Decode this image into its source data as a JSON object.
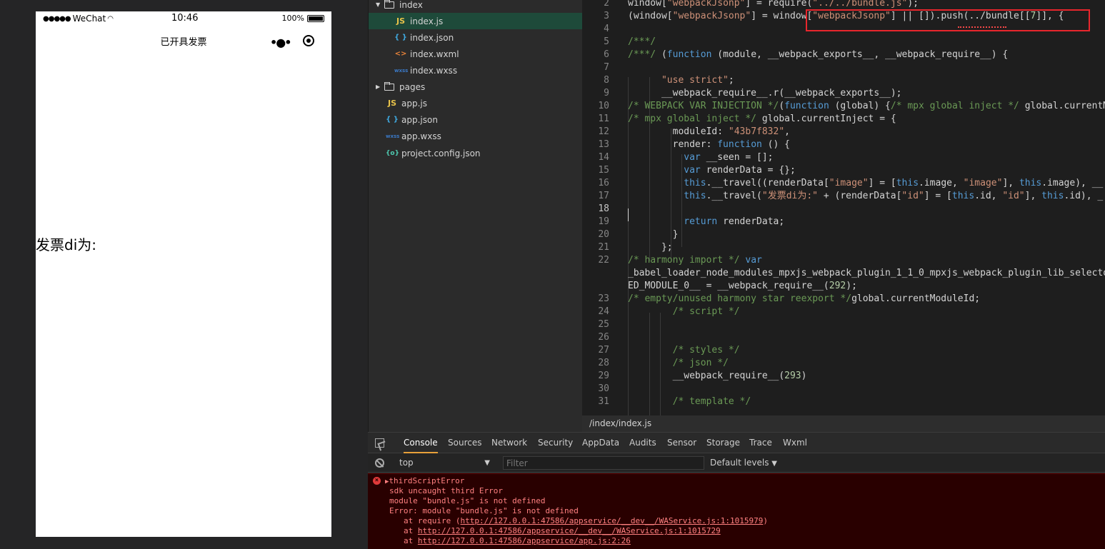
{
  "simulator": {
    "status": {
      "carrier": "WeChat",
      "time": "10:46",
      "battery": "100%"
    },
    "nav_title": "已开具发票",
    "page_text": "发票di为:"
  },
  "file_tree": {
    "items": [
      {
        "type": "folder-open",
        "label": "index"
      },
      {
        "type": "js",
        "label": "index.js",
        "selected": true
      },
      {
        "type": "json",
        "label": "index.json"
      },
      {
        "type": "wxml",
        "label": "index.wxml"
      },
      {
        "type": "wxss",
        "label": "index.wxss"
      },
      {
        "type": "folder-closed",
        "label": "pages"
      },
      {
        "type": "js",
        "label": "app.js"
      },
      {
        "type": "json",
        "label": "app.json"
      },
      {
        "type": "wxss",
        "label": "app.wxss"
      },
      {
        "type": "config",
        "label": "project.config.json"
      }
    ]
  },
  "editor": {
    "lines": [
      {
        "num": "2",
        "text": "window[\"webpackJsonp\"] = require(\"../../bundle.js\");"
      },
      {
        "num": "3",
        "text": "(window[\"webpackJsonp\"] = window[\"webpackJsonp\"] || []).push(../bundle[[7]], {"
      },
      {
        "num": "4",
        "text": ""
      },
      {
        "num": "5",
        "text": "/***/"
      },
      {
        "num": "6",
        "text": "/***/ (function (module, __webpack_exports__, __webpack_require__) {"
      },
      {
        "num": "7",
        "text": ""
      },
      {
        "num": "8",
        "text": "      \"use strict\";"
      },
      {
        "num": "9",
        "text": "      __webpack_require__.r(__webpack_exports__);"
      },
      {
        "num": "10",
        "text": "/* WEBPACK VAR INJECTION */(function (global) {/* mpx global inject */ global.currentMo"
      },
      {
        "num": "11",
        "text": "/* mpx global inject */ global.currentInject = {"
      },
      {
        "num": "12",
        "text": "        moduleId: \"43b7f832\","
      },
      {
        "num": "13",
        "text": "        render: function () {"
      },
      {
        "num": "14",
        "text": "          var __seen = [];"
      },
      {
        "num": "15",
        "text": "          var renderData = {};"
      },
      {
        "num": "16",
        "text": "          this.__travel((renderData[\"image\"] = [this.image, \"image\"], this.image), __"
      },
      {
        "num": "17",
        "text": "          this.__travel(\"发票di为:\" + (renderData[\"id\"] = [this.id, \"id\"], this.id), _"
      },
      {
        "num": "18",
        "text": ""
      },
      {
        "num": "19",
        "text": "          return renderData;"
      },
      {
        "num": "20",
        "text": "        }"
      },
      {
        "num": "21",
        "text": "      };"
      },
      {
        "num": "22",
        "text": "/* harmony import */ var"
      },
      {
        "num": "",
        "text": "_babel_loader_node_modules_mpxjs_webpack_plugin_1_1_0_mpxjs_webpack_plugin_lib_selector"
      },
      {
        "num": "",
        "text": "ED_MODULE_0__ = __webpack_require__(292);"
      },
      {
        "num": "23",
        "text": "/* empty/unused harmony star reexport */global.currentModuleId;"
      },
      {
        "num": "24",
        "text": "        /* script */"
      },
      {
        "num": "25",
        "text": ""
      },
      {
        "num": "26",
        "text": ""
      },
      {
        "num": "27",
        "text": "        /* styles */"
      },
      {
        "num": "28",
        "text": "        /* json */"
      },
      {
        "num": "29",
        "text": "        __webpack_require__(293)"
      },
      {
        "num": "30",
        "text": ""
      },
      {
        "num": "31",
        "text": "        /* template */"
      }
    ],
    "active_line": "18",
    "file_path": "/index/index.js"
  },
  "devtools": {
    "tabs": [
      "Console",
      "Sources",
      "Network",
      "Security",
      "AppData",
      "Audits",
      "Sensor",
      "Storage",
      "Trace",
      "Wxml"
    ],
    "active_tab": "Console",
    "context": "top",
    "filter_placeholder": "Filter",
    "levels": "Default levels",
    "console": {
      "header": "thirdScriptError",
      "lines": [
        "sdk uncaught third Error",
        "module \"bundle.js\" is not defined",
        "Error: module \"bundle.js\" is not defined"
      ],
      "stack": [
        {
          "prefix": "at require (",
          "link": "http://127.0.0.1:47586/appservice/__dev__/WAService.js:1:1015979",
          "suffix": ")"
        },
        {
          "prefix": "at ",
          "link": "http://127.0.0.1:47586/appservice/__dev__/WAService.js:1:1015729",
          "suffix": ""
        },
        {
          "prefix": "at ",
          "link": "http://127.0.0.1:47586/appservice/app.js:2:26",
          "suffix": ""
        }
      ]
    }
  }
}
